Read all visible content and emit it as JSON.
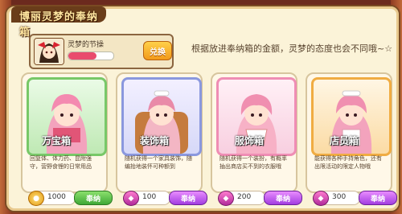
{
  "header": {
    "title": "博丽灵梦的奉纳箱"
  },
  "owner": {
    "name": "灵梦的节操",
    "hearts_fraction": 0.62,
    "swap_label": "兑换"
  },
  "hint": "根据放进奉纳箱的金额，灵梦的态度也会不同哦~☆",
  "cards": [
    {
      "name": "万宝箱",
      "desc": "回复体、体力药、昆附强守，营野食锂的日常用品",
      "price": "1000",
      "buy_label": "奉纳",
      "accent": "#7ccf6a",
      "price_kind": "coin"
    },
    {
      "name": "装饰箱",
      "desc": "随机获得一个家具装饰，随编抬地装怀可种额到",
      "price": "100",
      "buy_label": "奉纳",
      "accent": "#8b9ae0",
      "price_kind": "gem"
    },
    {
      "name": "服饰箱",
      "desc": "随机获得一个装扮，有概率抽出商店买不到的衣服哦",
      "price": "200",
      "buy_label": "奉纳",
      "accent": "#f08fb8",
      "price_kind": "gem"
    },
    {
      "name": "店员箱",
      "desc": "能获得各种手持角色，还有出限活动的限定人物哦",
      "price": "300",
      "buy_label": "奉纳",
      "accent": "#f3b24a",
      "price_kind": "gem"
    }
  ]
}
